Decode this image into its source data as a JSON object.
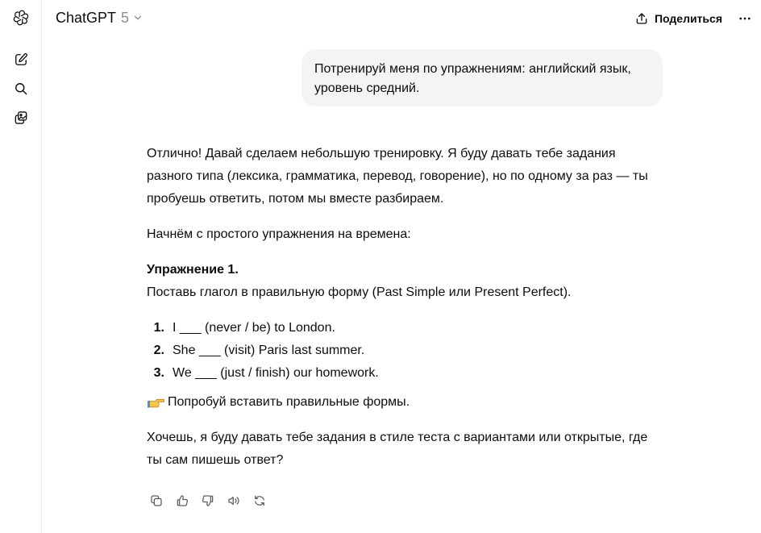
{
  "app": {
    "model_name": "ChatGPT",
    "model_version": "5"
  },
  "header": {
    "share_label": "Поделиться"
  },
  "icons": {
    "logo": "openai-logo-icon",
    "new_chat": "edit-pencil-icon",
    "search": "search-icon",
    "library": "library-images-icon",
    "share": "share-upload-icon",
    "more": "more-dots-icon",
    "hand": "backhand-index-pointing-right-icon"
  },
  "colors": {
    "user_bubble": "#f4f4f4",
    "text": "#0d0d0d",
    "muted": "#8f8f8f",
    "emoji": "#f6c64a"
  },
  "conversation": {
    "user_message": "Потренируй меня по упражнениям: английский язык, уровень средний.",
    "assistant": {
      "intro": "Отлично! Давай сделаем небольшую тренировку. Я буду давать тебе задания разного типа (лексика, грамматика, перевод, говорение), но по одному за раз — ты пробуешь ответить, потом мы вместе разбираем.",
      "start": "Начнём с простого упражнения на времена:",
      "exercise_title": "Упражнение 1.",
      "exercise_instruction": "Поставь глагол в правильную форму (Past Simple или Present Perfect).",
      "items": [
        {
          "num": "1.",
          "text": "I ___ (never / be) to London."
        },
        {
          "num": "2.",
          "text": "She ___ (visit) Paris last summer."
        },
        {
          "num": "3.",
          "text": "We ___ (just / finish) our homework."
        }
      ],
      "hint": "Попробуй вставить правильные формы.",
      "question": "Хочешь, я буду давать тебе задания в стиле теста с вариантами или открытые, где ты сам пишешь ответ?"
    }
  },
  "message_actions": [
    "copy-icon",
    "thumbs-up-icon",
    "thumbs-down-icon",
    "read-aloud-icon",
    "regenerate-icon"
  ]
}
